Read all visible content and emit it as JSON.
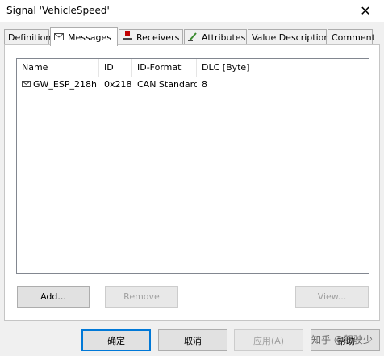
{
  "window": {
    "title": "Signal 'VehicleSpeed'",
    "close_glyph": "✕"
  },
  "tabs": [
    {
      "label": "Definition",
      "icon": ""
    },
    {
      "label": "Messages",
      "icon": "envelope-icon"
    },
    {
      "label": "Receivers",
      "icon": "receiver-icon"
    },
    {
      "label": "Attributes",
      "icon": "attribute-icon"
    },
    {
      "label": "Value Descriptions",
      "icon": ""
    },
    {
      "label": "Comment",
      "icon": ""
    }
  ],
  "active_tab": "Messages",
  "table": {
    "columns": [
      "Name",
      "ID",
      "ID-Format",
      "DLC [Byte]"
    ],
    "rows": [
      {
        "name": "GW_ESP_218h",
        "id": "0x218",
        "id_format": "CAN Standard",
        "dlc": "8"
      }
    ]
  },
  "buttons": {
    "add": "Add...",
    "remove": "Remove",
    "view": "View..."
  },
  "footer": {
    "ok": "确定",
    "cancel": "取消",
    "apply": "应用(A)",
    "help": "帮助"
  },
  "watermark": "知乎 @驾驶少",
  "colors": {
    "accent": "#0078d7",
    "receiver_icon": "#c00000",
    "attribute_icon": "#3a8a2e"
  }
}
